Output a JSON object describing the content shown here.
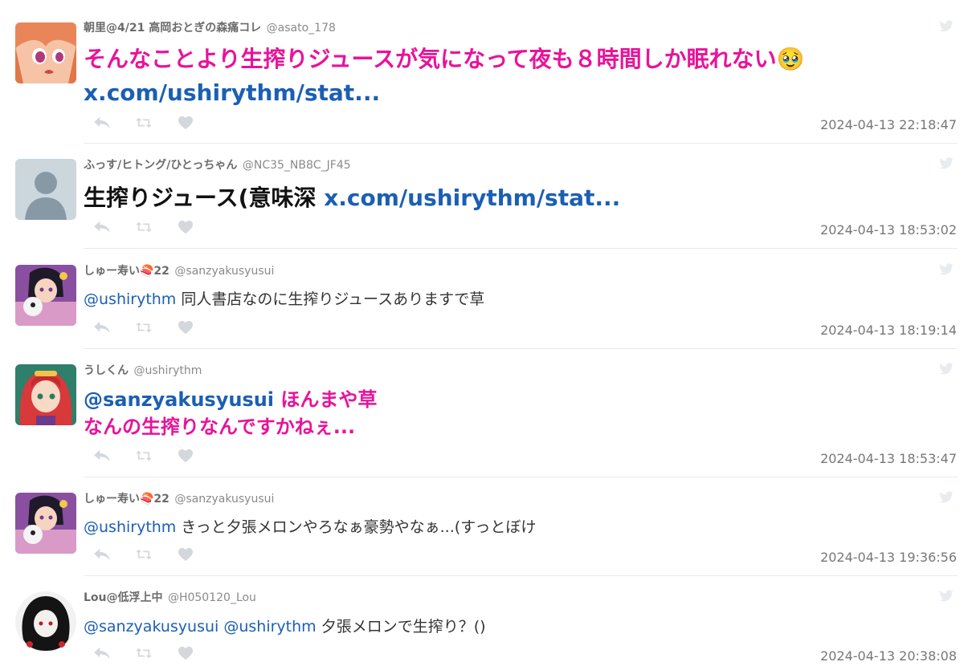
{
  "tweets": [
    {
      "name": "朝里@4/21 高岡おとぎの森痛コレ",
      "handle": "@asato_178",
      "text": "そんなことより生搾りジュースが気になって夜も８時間しか眠れない",
      "emoji": "🥹",
      "link": "x.com/ushirythm/stat...",
      "time": "2024-04-13 22:18:47"
    },
    {
      "name": "ふっす/ヒトング/ひとっちゃん",
      "handle": "@NC35_NB8C_JF45",
      "text": "生搾りジュース(意味深",
      "link": "x.com/ushirythm/stat...",
      "time": "2024-04-13 18:53:02"
    },
    {
      "name": "しゅー寿い🍣22",
      "handle": "@sanzyakusyusui",
      "mention": "@ushirythm",
      "text": "同人書店なのに生搾りジュースありますで草",
      "time": "2024-04-13 18:19:14"
    },
    {
      "name": "うしくん",
      "handle": "@ushirythm",
      "mention": "@sanzyakusyusui",
      "text_line1": "ほんまや草",
      "text_line2": "なんの生搾りなんですかねぇ...",
      "time": "2024-04-13 18:53:47"
    },
    {
      "name": "しゅー寿い🍣22",
      "handle": "@sanzyakusyusui",
      "mention": "@ushirythm",
      "text": "きっと夕張メロンやろなぁ豪勢やなぁ...(すっとぼけ",
      "time": "2024-04-13 19:36:56"
    },
    {
      "name": "Lou@低浮上中",
      "handle": "@H050120_Lou",
      "mention1": "@sanzyakusyusui",
      "mention2": "@ushirythm",
      "text": "夕張メロンで生搾り？()",
      "time": "2024-04-13 20:38:08"
    }
  ],
  "icons": {
    "reply": "reply-icon",
    "retweet": "retweet-icon",
    "like": "heart-icon",
    "source": "twitter-bird-icon"
  },
  "colors": {
    "pink_text": "#e8139a",
    "link": "#1b5fb4",
    "action_icon": "#d4d8dc",
    "timestamp": "#777777"
  }
}
